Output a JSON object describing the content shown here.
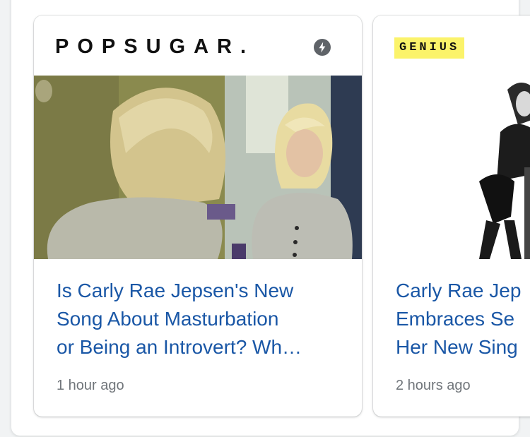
{
  "cards": [
    {
      "source": "POPSUGAR.",
      "headline": "Is Carly Rae Jepsen's New\nSong About Masturbation\nor Being an Introvert? Wh…",
      "time": "1 hour ago",
      "badge_icon": "amp-lightning-icon"
    },
    {
      "source": "GENIUS",
      "headline": "Carly Rae Jep\nEmbraces Se\nHer New Sing",
      "time": "2 hours ago",
      "badge_color": "#fbf36a"
    }
  ],
  "colors": {
    "headline": "#1a57a6",
    "timestamp": "#70757a",
    "amp_badge": "#5f6368"
  }
}
